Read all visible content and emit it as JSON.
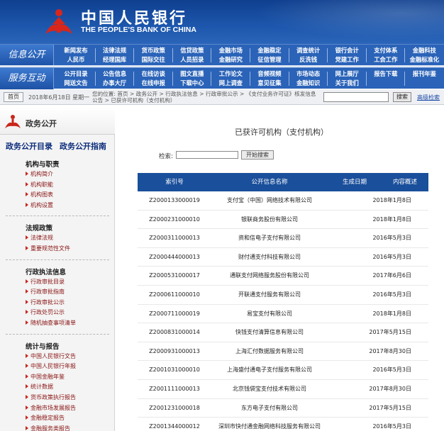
{
  "header": {
    "bank_cn": "中国人民银行",
    "bank_en": "THE PEOPLE'S BANK OF CHINA"
  },
  "nav": {
    "row1_label": "信息公开",
    "row2_label": "服务互动",
    "row1": [
      [
        "新闻发布",
        "人民币"
      ],
      [
        "法律法规",
        "经理国库"
      ],
      [
        "货币政策",
        "国际交往"
      ],
      [
        "信贷政策",
        "人员招录"
      ],
      [
        "金融市场",
        "金融研究"
      ],
      [
        "金融稳定",
        "征信管理"
      ],
      [
        "调查统计",
        "反洗钱"
      ],
      [
        "银行会计",
        "党建工作"
      ],
      [
        "支付体系",
        "工会工作"
      ],
      [
        "金融科技",
        "金融标准化"
      ]
    ],
    "row2": [
      [
        "公开目录",
        "网送文告"
      ],
      [
        "公告信息",
        "办事大厅"
      ],
      [
        "在线访谈",
        "在线申报"
      ],
      [
        "图文直播",
        "下载中心"
      ],
      [
        "工作论文",
        "网上调查"
      ],
      [
        "音频视频",
        "意见征集"
      ],
      [
        "市场动态",
        "金融知识"
      ],
      [
        "网上展厅",
        "关于我们"
      ],
      [
        "报告下载",
        ""
      ],
      [
        "报刊年鉴",
        ""
      ]
    ]
  },
  "crumbbar": {
    "home": "首页",
    "date": "2018年6月18日 星期一",
    "crumb": "您的位置: 首页 > 政务公开 > 行政执法信息 > 行政审批公示 > 《支付业务许可证》核发信息公告 > 已获许可机构（支付机构）",
    "search_button": "搜索",
    "advanced": "高级检索"
  },
  "sidebar": {
    "title": "政务公开",
    "link1": "政务公开目录",
    "link2": "政务公开指南",
    "groups": [
      {
        "title": "机构与职责",
        "items": [
          "机构简介",
          "机构职能",
          "机构图表",
          "机构设置"
        ]
      },
      {
        "title": "法规政策",
        "items": [
          "法律法规",
          "重要规范性文件"
        ]
      },
      {
        "title": "行政执法信息",
        "items": [
          "行政审批目录",
          "行政审批指南",
          "行政审批公示",
          "行政处罚公示",
          "随机抽查事项清单"
        ]
      },
      {
        "title": "统计与报告",
        "items": [
          "中国人民银行文告",
          "中国人民银行年报",
          "中国金融年鉴",
          "统计数据",
          "货币政策执行报告",
          "金融市场发展报告",
          "金融稳定报告",
          "金融服务类报告"
        ]
      }
    ]
  },
  "main": {
    "title": "已获许可机构（支付机构）",
    "search_label": "检索:",
    "search_button": "开始搜索",
    "columns": [
      "索引号",
      "公开信息名称",
      "生成日期",
      "内容概述"
    ],
    "rows": [
      {
        "id": "Z2000133000019",
        "name": "支付宝（中国）网络技术有限公司",
        "date": "2018年1月8日"
      },
      {
        "id": "Z2000231000010",
        "name": "银联商务股份有限公司",
        "date": "2018年1月8日"
      },
      {
        "id": "Z2000311000013",
        "name": "资和信电子支付有限公司",
        "date": "2016年5月3日"
      },
      {
        "id": "Z2000444000013",
        "name": "财付通支付科技有限公司",
        "date": "2016年5月3日"
      },
      {
        "id": "Z2000531000017",
        "name": "通联支付网络服务股份有限公司",
        "date": "2017年6月6日"
      },
      {
        "id": "Z2000611000010",
        "name": "开联通支付服务有限公司",
        "date": "2016年5月3日"
      },
      {
        "id": "Z2000711000019",
        "name": "易宝支付有限公司",
        "date": "2018年1月8日"
      },
      {
        "id": "Z2000831000014",
        "name": "快钱支付清算信息有限公司",
        "date": "2017年5月15日"
      },
      {
        "id": "Z2000931000013",
        "name": "上海汇付数据服务有限公司",
        "date": "2017年8月30日"
      },
      {
        "id": "Z2001031000010",
        "name": "上海盛付通电子支付服务有限公司",
        "date": "2016年5月3日"
      },
      {
        "id": "Z2001111000013",
        "name": "北京钱袋宝支付技术有限公司",
        "date": "2017年8月30日"
      },
      {
        "id": "Z2001231000018",
        "name": "东方电子支付有限公司",
        "date": "2017年5月15日"
      },
      {
        "id": "Z2001344000012",
        "name": "深圳市快付通金融网络科技服务有限公司",
        "date": "2016年5月3日"
      }
    ]
  },
  "colors": {
    "nav_blue": "#2a63b8",
    "table_header": "#1a4f9b",
    "accent_red": "#c8261c"
  }
}
